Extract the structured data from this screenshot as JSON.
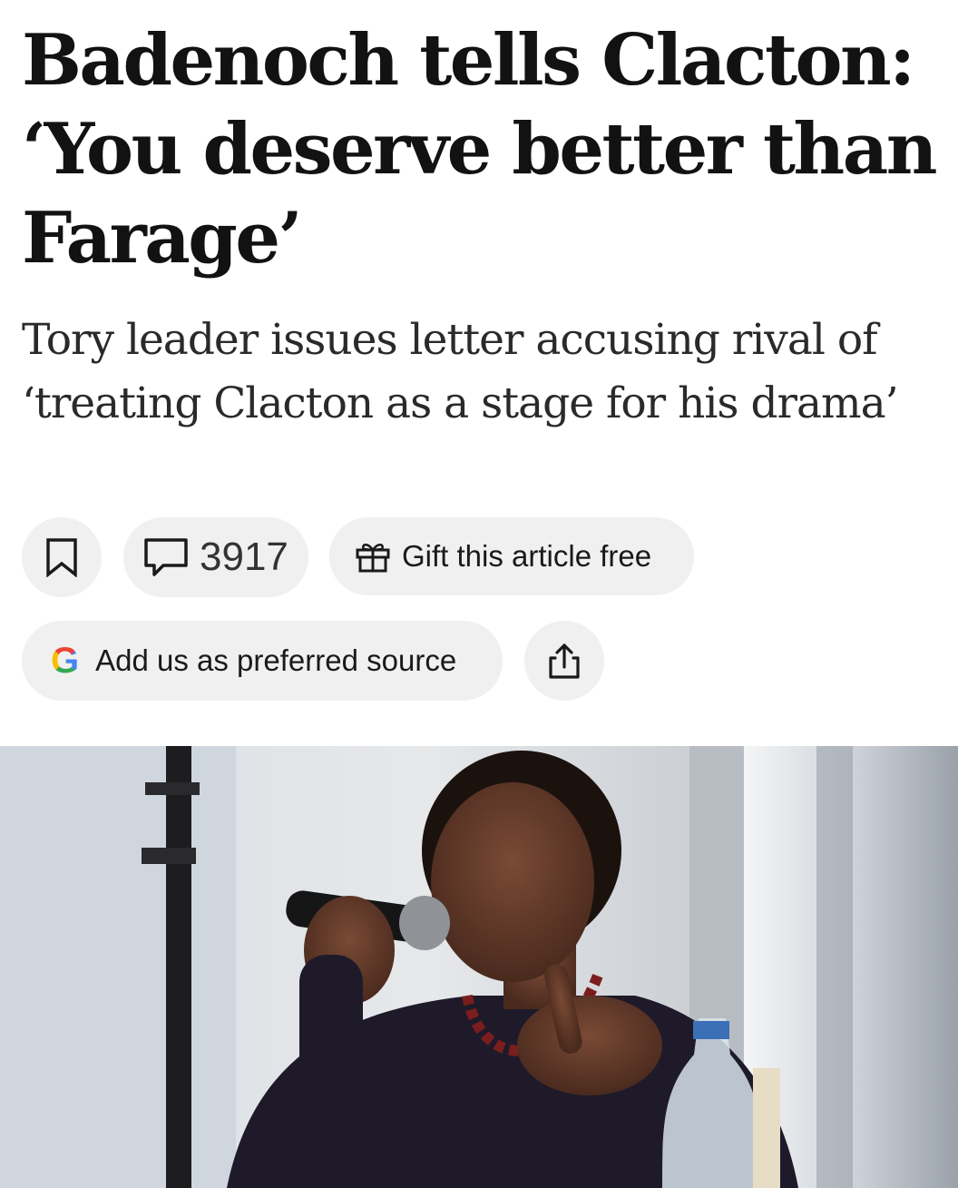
{
  "article": {
    "headline": "Badenoch tells Clacton: ‘You deserve better than Farage’",
    "standfirst": "Tory leader issues letter accusing rival of ‘treating Clacton as a stage for his drama’"
  },
  "actions": {
    "comment_count": "3917",
    "gift_label": "Gift this article free",
    "preferred_source_label": "Add us as preferred source",
    "google_glyph": "G"
  },
  "icons": {
    "bookmark": "bookmark-icon",
    "comment": "speech-bubble-icon",
    "gift": "gift-icon",
    "google": "google-g-icon",
    "share": "share-icon"
  },
  "colors": {
    "pill_background": "#f0f0f0",
    "text": "#1a1a1a",
    "google_blue": "#4285f4",
    "google_red": "#ea4335",
    "google_yellow": "#fbbc05",
    "google_green": "#34a853"
  }
}
